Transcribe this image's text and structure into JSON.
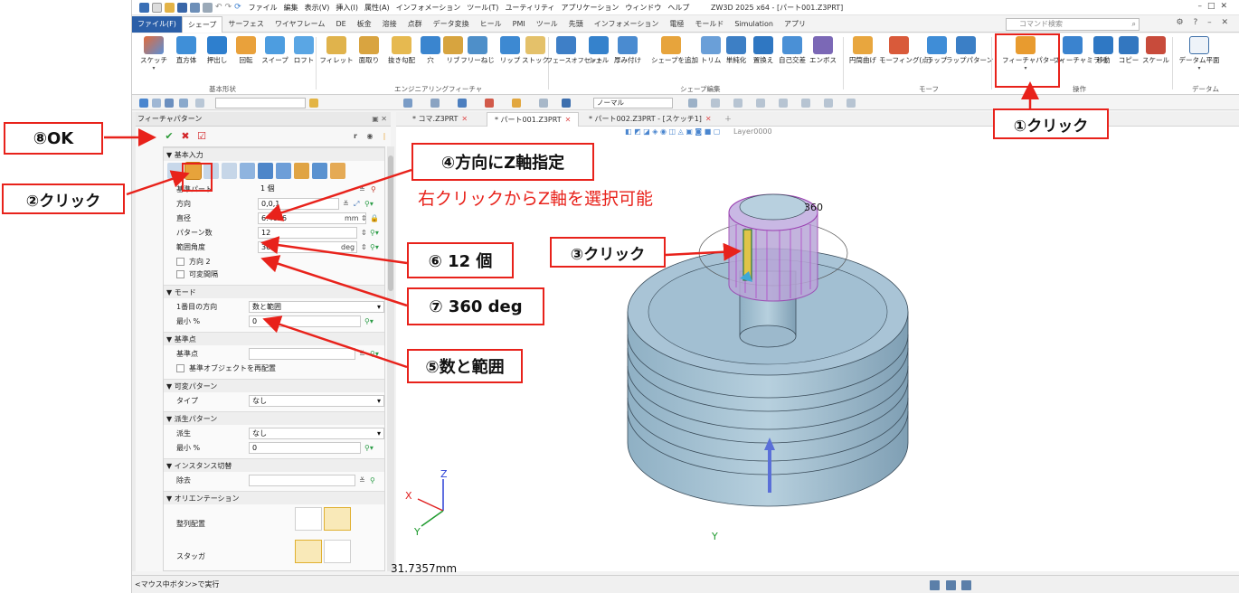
{
  "window": {
    "title": "ZW3D 2025 x64 - [パート001.Z3PRT]",
    "menu": [
      "ファイル",
      "編集",
      "表示(V)",
      "挿入(I)",
      "属性(A)",
      "インフォメーション",
      "ツール(T)",
      "ユーティリティ",
      "アプリケーション",
      "ウィンドウ",
      "ヘルプ"
    ]
  },
  "ribbon_tabs": [
    "ファイル(F)",
    "シェープ",
    "サーフェス",
    "ワイヤフレーム",
    "DE",
    "板金",
    "溶接",
    "点群",
    "データ変換",
    "ヒール",
    "PMI",
    "ツール",
    "先頭",
    "インフォメーション",
    "電極",
    "モールド",
    "Simulation",
    "アプリ"
  ],
  "active_ribbon_tab": "シェープ",
  "command_search_placeholder": "コマンド検索",
  "ribbon_buttons": [
    {
      "label": "スケッチ"
    },
    {
      "label": "直方体"
    },
    {
      "label": "押出し"
    },
    {
      "label": "回転"
    },
    {
      "label": "スイープ"
    },
    {
      "label": "ロフト"
    },
    {
      "label": "フィレット"
    },
    {
      "label": "面取り"
    },
    {
      "label": "抜き勾配"
    },
    {
      "label": "穴"
    },
    {
      "label": "リブ"
    },
    {
      "label": "フリーねじ"
    },
    {
      "label": "リップ"
    },
    {
      "label": "ストック"
    },
    {
      "label": "フェースオフセット"
    },
    {
      "label": "シェル"
    },
    {
      "label": "厚み付け"
    },
    {
      "label": "シェープを追加"
    },
    {
      "label": "トリム"
    },
    {
      "label": "単純化"
    },
    {
      "label": "置換え"
    },
    {
      "label": "自己交差"
    },
    {
      "label": "エンボス"
    },
    {
      "label": "円筒曲げ"
    },
    {
      "label": "モーフィング(点)"
    },
    {
      "label": "ラップ"
    },
    {
      "label": "ラップパターン"
    },
    {
      "label": "フィーチャパターン"
    },
    {
      "label": "フィーチャミラー"
    },
    {
      "label": "移動"
    },
    {
      "label": "コピー"
    },
    {
      "label": "スケール"
    },
    {
      "label": "データム平面"
    }
  ],
  "ribbon_groups": [
    "基本形状",
    "エンジニアリングフィーチャ",
    "シェープ編集",
    "モーフ",
    "操作",
    "データム"
  ],
  "toolbar2": {
    "style_box": "ノーマル"
  },
  "panel": {
    "title": "フィーチャパターン",
    "sections": {
      "basic": "基本入力",
      "mode": "モード",
      "base_point": "基準点",
      "variable": "可変パターン",
      "derived": "派生パターン",
      "instance": "インスタンス切替",
      "orientation": "オリエンテーション"
    },
    "fields": {
      "base_part_label": "基準パート",
      "base_part_value": "1 個",
      "direction_label": "方向",
      "direction_value": "0,0,1",
      "diameter_label": "直径",
      "diameter_value": "6.4626",
      "diameter_unit": "mm",
      "count_label": "パターン数",
      "count_value": "12",
      "range_label": "範囲角度",
      "range_value": "360",
      "range_unit": "deg",
      "direction2_label": "方向 2",
      "variable_spacing_label": "可変間隔",
      "first_direction_label": "1番目の方向",
      "first_direction_value": "数と範囲",
      "min_pct_label": "最小 %",
      "min_pct_value": "0",
      "base_point_label": "基準点",
      "base_point_value": "",
      "reposition_label": "基準オブジェクトを再配置",
      "type_label": "タイプ",
      "type_value": "なし",
      "derive_label": "派生",
      "derive_value": "なし",
      "min_pct2_label": "最小 %",
      "min_pct2_value": "0",
      "remove_label": "除去",
      "arrange_label": "整列配置",
      "stagger_label": "スタッガ"
    }
  },
  "doc_tabs": [
    "* コマ.Z3PRT",
    "* パート001.Z3PRT",
    "* パート002.Z3PRT - [スケッチ1]"
  ],
  "layer_box": "Layer0000",
  "viewport": {
    "angle_label": "360",
    "distance": "31.7357mm"
  },
  "axes": {
    "x": "X",
    "y": "Y",
    "z": "Z"
  },
  "status_text": "<マウス中ボタン>で実行",
  "annotations": {
    "c1": "①クリック",
    "c2": "②クリック",
    "c3": "③クリック",
    "c4": "④方向にZ軸指定",
    "c4_note": "右クリックからZ軸を選択可能",
    "c5": "⑤数と範囲",
    "c6": "⑥ 12 個",
    "c7": "⑦ 360 deg",
    "c8": "⑧OK"
  },
  "colors": {
    "accent": "#e8221b",
    "file_tab": "#2b5fa8",
    "model": "#a9c4d6",
    "model_dark": "#7f9fb4"
  }
}
